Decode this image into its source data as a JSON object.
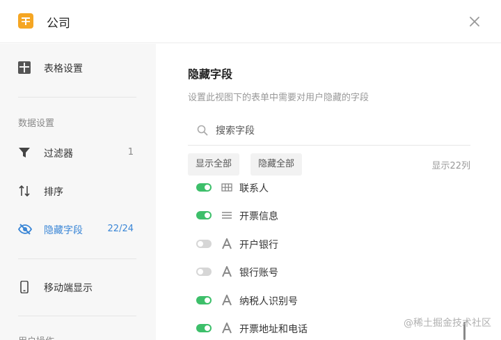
{
  "window": {
    "title": "公司"
  },
  "sidebar": {
    "table_settings": {
      "label": "表格设置"
    },
    "section_data": "数据设置",
    "filter": {
      "label": "过滤器",
      "count": "1"
    },
    "sort": {
      "label": "排序"
    },
    "hide_fields": {
      "label": "隐藏字段",
      "count": "22/24"
    },
    "mobile": {
      "label": "移动端显示"
    },
    "section_user": "用户操作"
  },
  "main": {
    "title": "隐藏字段",
    "description": "设置此视图下的表单中需要对用户隐藏的字段",
    "search_placeholder": "搜索字段",
    "show_all": "显示全部",
    "hide_all": "隐藏全部",
    "shown_count": "显示22列"
  },
  "fields": [
    {
      "name": "联系人",
      "visible": true,
      "type": "grid-icon"
    },
    {
      "name": "开票信息",
      "visible": true,
      "type": "lines-icon"
    },
    {
      "name": "开户银行",
      "visible": false,
      "type": "text-icon"
    },
    {
      "name": "银行账号",
      "visible": false,
      "type": "text-icon"
    },
    {
      "name": "纳税人识别号",
      "visible": true,
      "type": "text-icon"
    },
    {
      "name": "开票地址和电话",
      "visible": true,
      "type": "text-icon"
    }
  ],
  "watermark": "@稀土掘金技术社区",
  "colors": {
    "accent": "#3a86d6",
    "toggle_on": "#3dbf6a",
    "toggle_off": "#d6d6d6",
    "app_icon": "#f5a623"
  }
}
